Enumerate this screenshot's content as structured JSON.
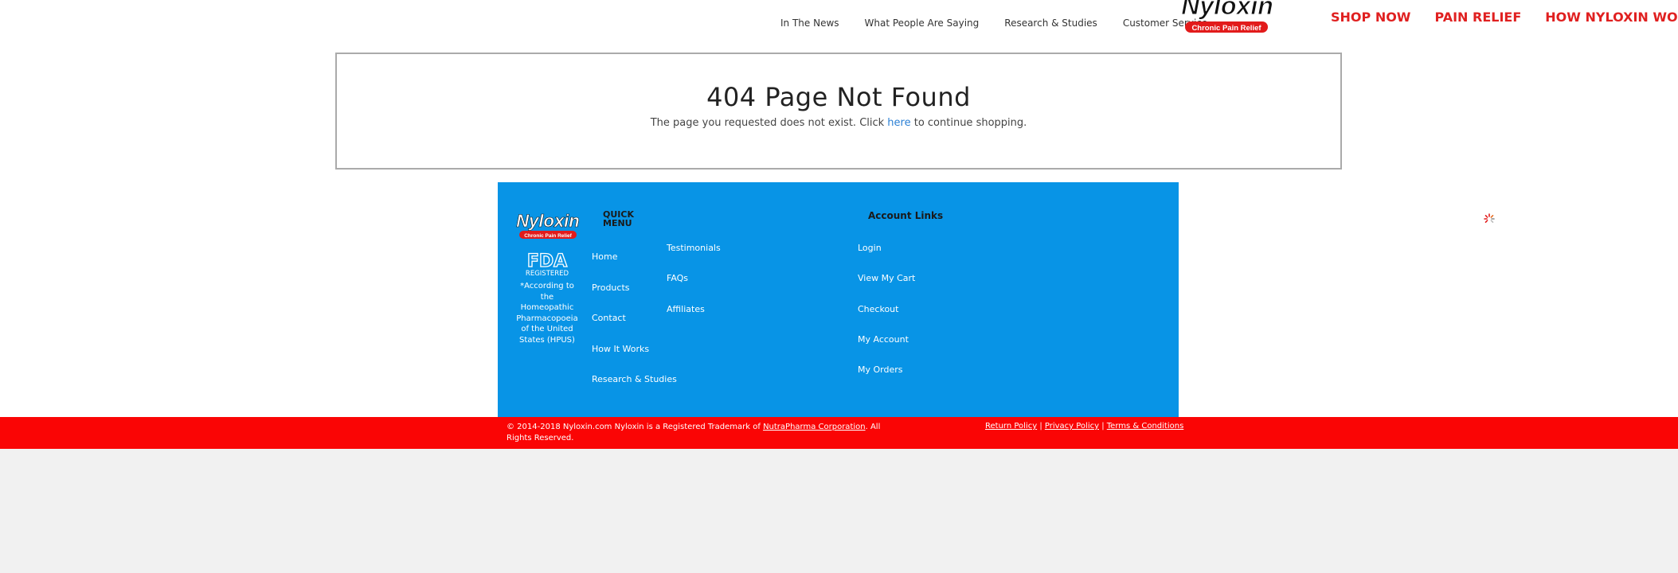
{
  "header": {
    "top_nav": [
      "In The News",
      "What People Are Saying",
      "Research & Studies",
      "Customer Service"
    ],
    "logo": {
      "name": "Nyloxin",
      "tagline": "Chronic Pain Relief"
    },
    "main_nav": [
      "SHOP NOW",
      "PAIN RELIEF",
      "HOW NYLOXIN WORKS"
    ]
  },
  "notfound": {
    "title": "404 Page Not Found",
    "text_before": "The page you requested does not exist. Click ",
    "link_text": "here",
    "text_after": " to continue shopping."
  },
  "footer": {
    "logo": {
      "name": "Nyloxin",
      "tagline": "Chronic Pain Relief"
    },
    "fda": {
      "mark": "FDA",
      "label": "REGISTERED"
    },
    "fda_note": "*According to the Homeopathic Pharmacopoeia of the United States (HPUS)",
    "quick_menu_title": "QUICK MENU",
    "quick_menu_col1": [
      "Home",
      "Products",
      "Contact",
      "How It Works",
      "Research & Studies"
    ],
    "quick_menu_col2": [
      "Testimonials",
      "FAQs",
      "Affiliates"
    ],
    "account_title": "Account Links",
    "account_links": [
      "Login",
      "View My Cart",
      "Checkout",
      "My Account",
      "My Orders"
    ]
  },
  "bottom": {
    "copyright_before": "© 2014-2018 Nyloxin.com Nyloxin is a Registered Trademark of ",
    "copyright_link": "NutraPharma Corporation",
    "copyright_after": ". All Rights Reserved.",
    "policies": [
      "Return Policy",
      "Privacy Policy",
      "Terms & Conditions"
    ],
    "separator": " | "
  },
  "colors": {
    "footer_bg": "#0894e6",
    "bottom_bar": "#fa0505",
    "main_nav": "#e02020",
    "link": "#2a7fd4"
  },
  "icons": {
    "floating_widget": "spinner-icon"
  }
}
